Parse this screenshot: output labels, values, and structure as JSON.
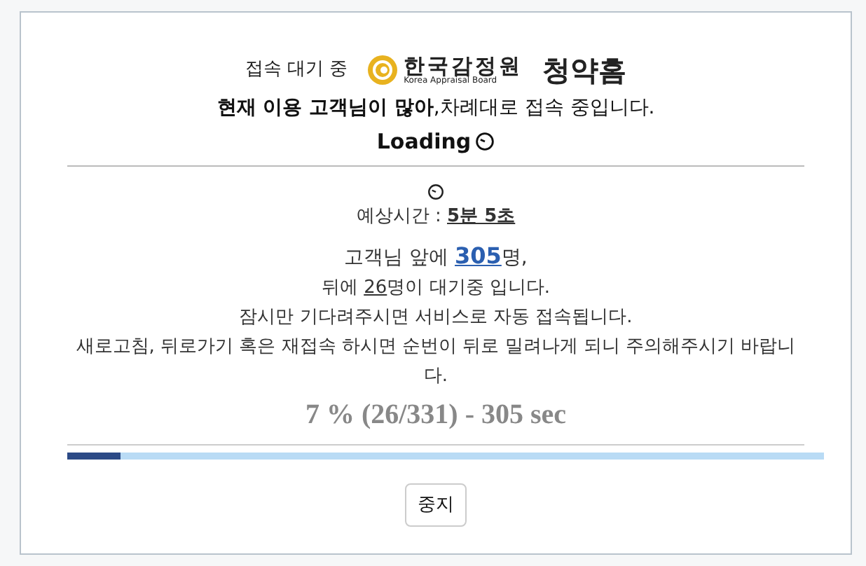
{
  "header": {
    "status": "접속 대기 중",
    "logo_name": "한국감정원",
    "logo_subtitle": "Korea Appraisal Board",
    "service": "청약홈"
  },
  "notice": "**현재 이용 고객님이 많아**,차례대로 접속 중입니다.",
  "loading": "Loading",
  "estimate": {
    "label": "예상시간 :",
    "value": "5분 5초"
  },
  "queue_ahead": {
    "before": "고객님 앞에 ",
    "count": "305",
    "after": "명,"
  },
  "queue_behind": {
    "before": "뒤에 ",
    "count": "26",
    "after": "명이 대기중 입니다."
  },
  "messages": [
    "잠시만 기다려주시면 서비스로 자동 접속됩니다.",
    "새로고침, 뒤로가기 혹은 재접속 하시면 순번이 뒤로 밀려나게 되니 주의해주시기 바랍니다."
  ],
  "progress_text": "7 % (26/331) - 305 sec",
  "progress": {
    "level": 0.07
  },
  "buttons": [
    "중지"
  ]
}
